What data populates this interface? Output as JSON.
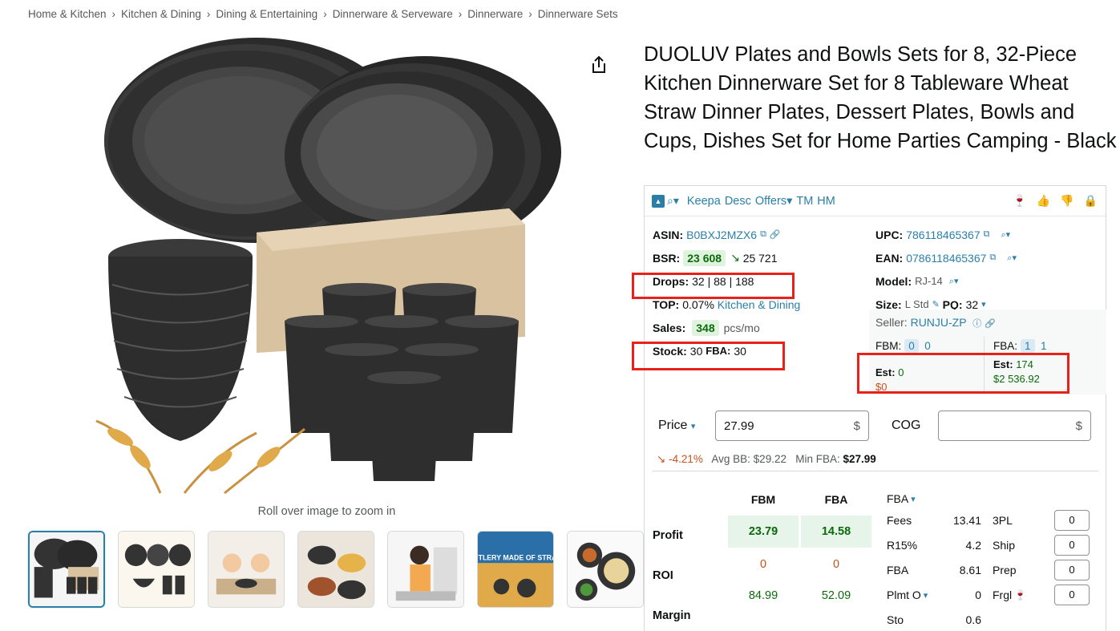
{
  "breadcrumb": [
    "Home & Kitchen",
    "Kitchen & Dining",
    "Dining & Entertaining",
    "Dinnerware & Serveware",
    "Dinnerware",
    "Dinnerware Sets"
  ],
  "product": {
    "title": "DUOLUV Plates and Bowls Sets for 8, 32-Piece Kitchen Dinnerware Set for 8 Tableware Wheat Straw Dinner Plates, Dessert Plates, Bowls and Cups, Dishes Set for Home Parties Camping - Black",
    "zoom_hint": "Roll over image to zoom in",
    "thumb_count": 7,
    "thumb_text_5": "CUTLERY MADE OF STRAW"
  },
  "keepa": {
    "header_links": [
      "Keepa",
      "Desc",
      "Offers",
      "TM",
      "HM"
    ],
    "asin_label": "ASIN:",
    "asin": "B0BXJ2MZX6",
    "bsr_label": "BSR:",
    "bsr": "23 608",
    "bsr_prev": "25 721",
    "drops_label": "Drops:",
    "drops": "32 | 88 | 188",
    "top_label": "TOP:",
    "top_pct": "0.07%",
    "top_cat": "Kitchen & Dining",
    "sales_label": "Sales:",
    "sales": "348",
    "sales_unit": "pcs/mo",
    "stock_label": "Stock:",
    "stock": "30",
    "stock_fba_label": "FBA:",
    "stock_fba": "30",
    "upc_label": "UPC:",
    "upc": "786118465367",
    "ean_label": "EAN:",
    "ean": "0786118465367",
    "model_label": "Model:",
    "model": "RJ-14",
    "size_label": "Size:",
    "size": "L Std",
    "pq_label": "PQ:",
    "pq": "32",
    "seller_label": "Seller:",
    "seller": "RUNJU-ZP",
    "fbm_label": "FBM:",
    "fbm_a": "0",
    "fbm_b": "0",
    "fba_label": "FBA:",
    "fba_a": "1",
    "fba_b": "1",
    "est_label": "Est:",
    "est_fbm": "0",
    "est_fbm_money": "$0",
    "est_fba": "174",
    "est_fba_money": "$2 536.92",
    "price_label": "Price",
    "price_value": "27.99",
    "currency": "$",
    "cog_label": "COG",
    "change_pct": "-4.21%",
    "avg_bb_label": "Avg BB:",
    "avg_bb": "$29.22",
    "min_fba_label": "Min FBA:",
    "min_fba": "$27.99",
    "col_fbm": "FBM",
    "col_fba": "FBA",
    "profit_label": "Profit",
    "profit_fbm": "23.79",
    "profit_fba": "14.58",
    "roi_label": "ROI",
    "roi_fbm": "0",
    "roi_fba": "0",
    "margin_label": "Margin",
    "margin_fbm": "84.99",
    "margin_fba": "52.09",
    "fees_select": "FBA",
    "fees": [
      {
        "label": "Fees",
        "value": "13.41",
        "extra": "3PL",
        "input": "0"
      },
      {
        "label": "R15%",
        "value": "4.2",
        "extra": "Ship",
        "input": "0"
      },
      {
        "label": "FBA",
        "value": "8.61",
        "extra": "Prep",
        "input": "0"
      },
      {
        "label": "Plmt O",
        "value": "0",
        "extra": "Frgl",
        "input": "0"
      },
      {
        "label": "Sto",
        "value": "0.6"
      }
    ]
  }
}
